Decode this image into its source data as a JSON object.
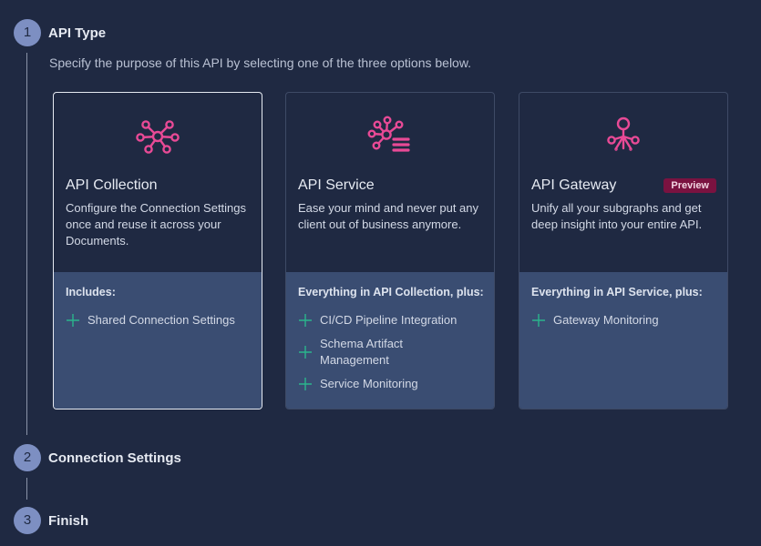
{
  "steps": [
    {
      "number": "1",
      "title": "API Type"
    },
    {
      "number": "2",
      "title": "Connection Settings"
    },
    {
      "number": "3",
      "title": "Finish"
    }
  ],
  "description": "Specify the purpose of this API by selecting one of the three options below.",
  "cards": [
    {
      "icon": "network-hub-icon",
      "title": "API Collection",
      "text": "Configure the Connection Settings once and reuse it across your Documents.",
      "includes_title": "Includes:",
      "features": [
        "Shared Connection Settings"
      ],
      "selected": true
    },
    {
      "icon": "network-service-icon",
      "title": "API Service",
      "text": "Ease your mind and never put any client out of business anymore.",
      "includes_title": "Everything in API Collection, plus:",
      "features": [
        "CI/CD Pipeline Integration",
        "Schema Artifact Management",
        "Service Monitoring"
      ],
      "selected": false
    },
    {
      "icon": "gateway-tree-icon",
      "title": "API Gateway",
      "badge": "Preview",
      "text": "Unify all your subgraphs and get deep insight into your entire API.",
      "includes_title": "Everything in API Service, plus:",
      "features": [
        "Gateway Monitoring"
      ],
      "selected": false
    }
  ],
  "colors": {
    "accent_pink": "#e84a96",
    "plus_green": "#2ab58c",
    "badge_bg": "#7a1240"
  }
}
